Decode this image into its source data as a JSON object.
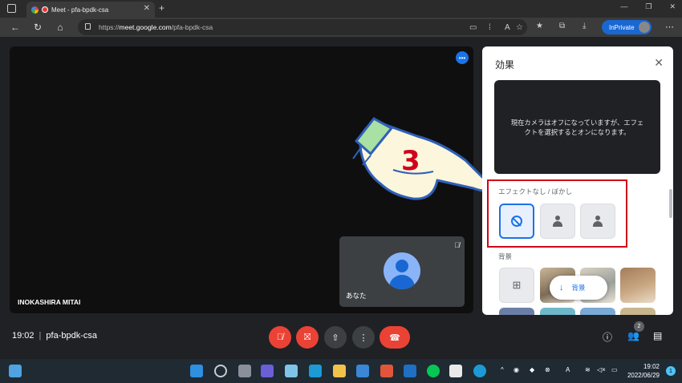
{
  "browser": {
    "tab_title": "Meet - pfa-bpdk-csa",
    "url_prefix": "https://",
    "url_host": "meet.google.com",
    "url_path": "/pfa-bpdk-csa",
    "inprivate_label": "InPrivate"
  },
  "meet": {
    "participant_name": "INOKASHIRA MITAI",
    "self_label": "あなた",
    "time": "19:02",
    "meeting_code": "pfa-bpdk-csa",
    "people_count": "2"
  },
  "annotation": {
    "step_number": "3"
  },
  "effects_panel": {
    "title": "効果",
    "preview_message": "現在カメラはオフになっていますが、エフェクトを選択するとオンになります。",
    "blur_section_label": "エフェクトなし / ぼかし",
    "background_section_label": "背景",
    "background_pill_label": "背景"
  },
  "taskbar": {
    "time": "19:02",
    "date": "2022/06/29",
    "notification_count": "1"
  },
  "colors": {
    "meet_background": "#202124",
    "accent_blue": "#1a73e8",
    "danger_red": "#ea4335",
    "highlight_box": "#d0021b"
  }
}
